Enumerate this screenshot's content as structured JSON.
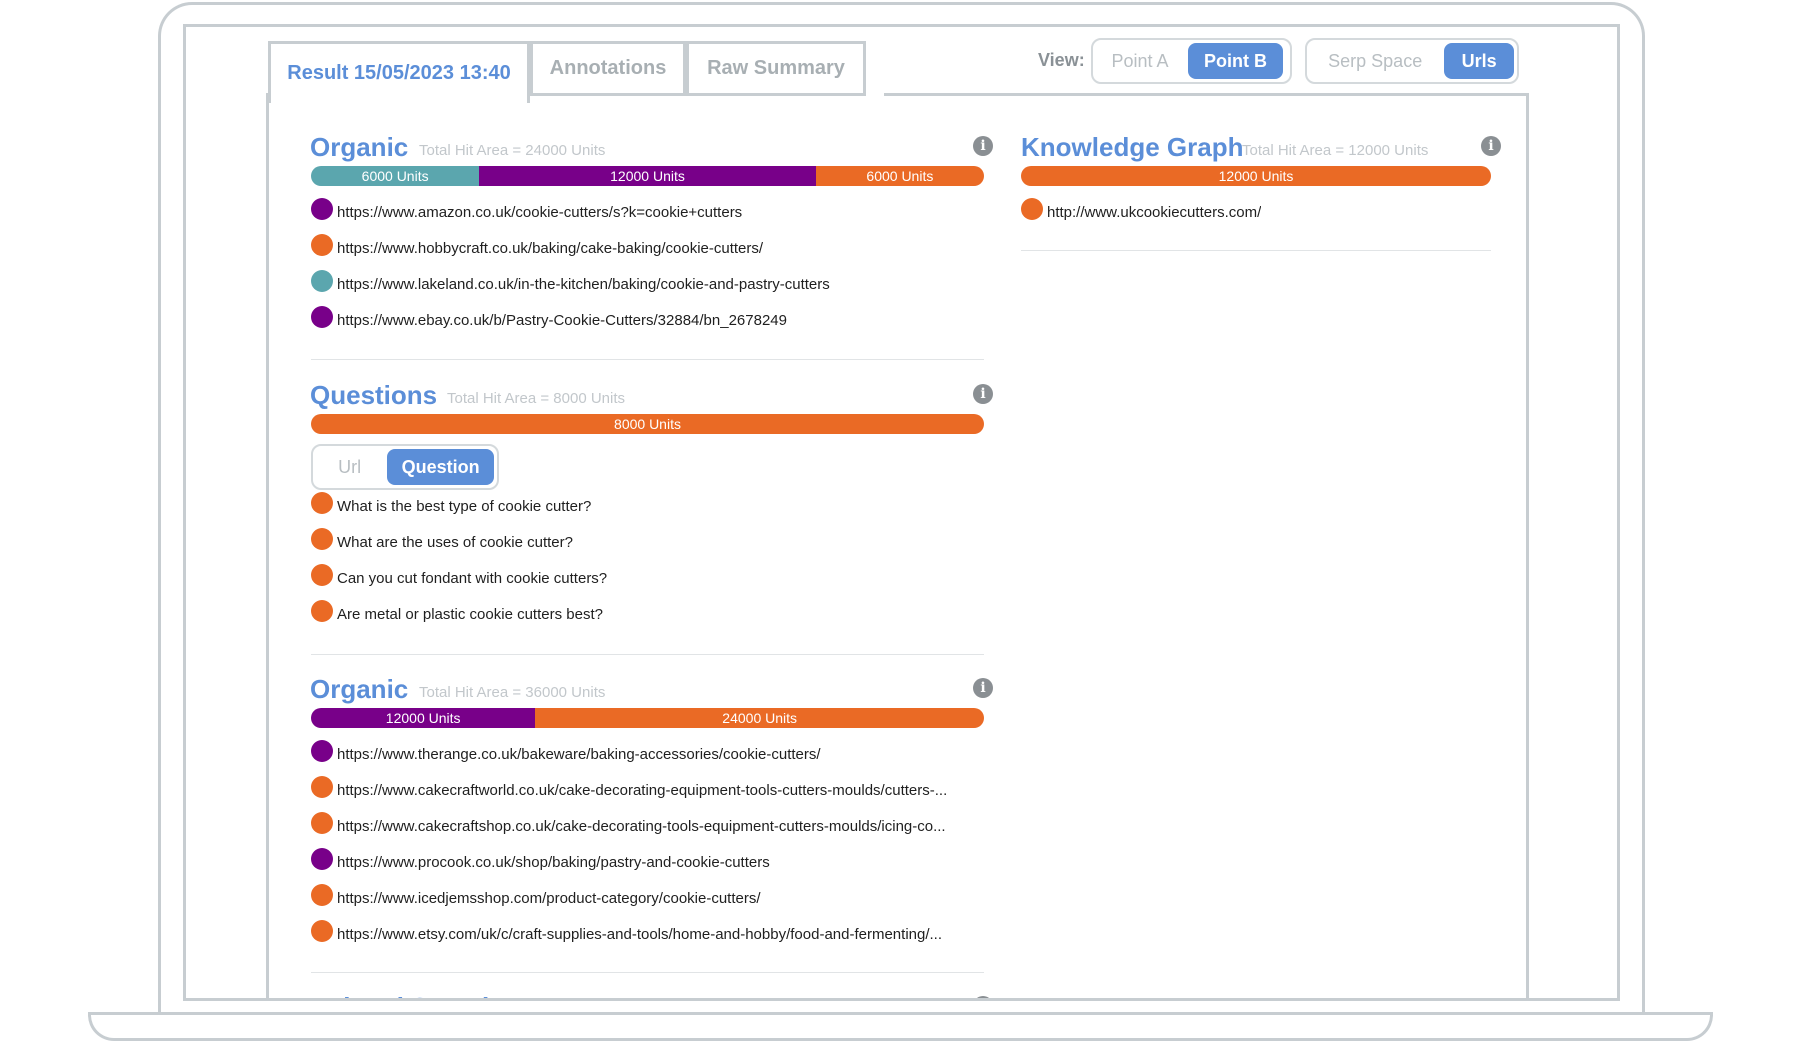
{
  "tabs": [
    {
      "label": "Result 15/05/2023 13:40",
      "active": true
    },
    {
      "label": "Annotations",
      "active": false
    },
    {
      "label": "Raw Summary",
      "active": false
    }
  ],
  "view": {
    "label": "View:",
    "point_group": [
      {
        "label": "Point A",
        "selected": false
      },
      {
        "label": "Point B",
        "selected": true
      }
    ],
    "space_group": [
      {
        "label": "Serp Space",
        "selected": false
      },
      {
        "label": "Urls",
        "selected": true
      }
    ]
  },
  "colors": {
    "teal": "#5ba6ae",
    "purple": "#780089",
    "orange": "#ea6a25",
    "accent": "#5b8ed8"
  },
  "sections": {
    "organic1": {
      "title": "Organic",
      "subtitle": "Total Hit Area = 24000 Units",
      "bar": [
        {
          "label": "6000 Units",
          "value": 6000,
          "color": "teal"
        },
        {
          "label": "12000 Units",
          "value": 12000,
          "color": "purple"
        },
        {
          "label": "6000 Units",
          "value": 6000,
          "color": "orange"
        }
      ],
      "items": [
        {
          "text": "https://www.amazon.co.uk/cookie-cutters/s?k=cookie+cutters",
          "color": "purple"
        },
        {
          "text": "https://www.hobbycraft.co.uk/baking/cake-baking/cookie-cutters/",
          "color": "orange"
        },
        {
          "text": "https://www.lakeland.co.uk/in-the-kitchen/baking/cookie-and-pastry-cutters",
          "color": "teal"
        },
        {
          "text": "https://www.ebay.co.uk/b/Pastry-Cookie-Cutters/32884/bn_2678249",
          "color": "purple"
        }
      ]
    },
    "knowledge": {
      "title": "Knowledge Graph",
      "subtitle": "Total Hit Area = 12000 Units",
      "bar": [
        {
          "label": "12000 Units",
          "value": 12000,
          "color": "orange"
        }
      ],
      "items": [
        {
          "text": "http://www.ukcookiecutters.com/",
          "color": "orange"
        }
      ]
    },
    "questions": {
      "title": "Questions",
      "subtitle": "Total Hit Area = 8000 Units",
      "bar": [
        {
          "label": "8000 Units",
          "value": 8000,
          "color": "orange"
        }
      ],
      "toggle": [
        {
          "label": "Url",
          "selected": false
        },
        {
          "label": "Question",
          "selected": true
        }
      ],
      "items": [
        {
          "text": "What is the best type of cookie cutter?",
          "color": "orange"
        },
        {
          "text": "What are the uses of cookie cutter?",
          "color": "orange"
        },
        {
          "text": "Can you cut fondant with cookie cutters?",
          "color": "orange"
        },
        {
          "text": "Are metal or plastic cookie cutters best?",
          "color": "orange"
        }
      ]
    },
    "organic2": {
      "title": "Organic",
      "subtitle": "Total Hit Area = 36000 Units",
      "bar": [
        {
          "label": "12000 Units",
          "value": 12000,
          "color": "purple"
        },
        {
          "label": "24000 Units",
          "value": 24000,
          "color": "orange"
        }
      ],
      "items": [
        {
          "text": "https://www.therange.co.uk/bakeware/baking-accessories/cookie-cutters/",
          "color": "purple"
        },
        {
          "text": "https://www.cakecraftworld.co.uk/cake-decorating-equipment-tools-cutters-moulds/cutters-...",
          "color": "orange"
        },
        {
          "text": "https://www.cakecraftshop.co.uk/cake-decorating-tools-equipment-cutters-moulds/icing-co...",
          "color": "orange"
        },
        {
          "text": "https://www.procook.co.uk/shop/baking/pastry-and-cookie-cutters",
          "color": "purple"
        },
        {
          "text": "https://www.icedjemsshop.com/product-category/cookie-cutters/",
          "color": "orange"
        },
        {
          "text": "https://www.etsy.com/uk/c/craft-supplies-and-tools/home-and-hobby/food-and-fermenting/...",
          "color": "orange"
        }
      ]
    },
    "related": {
      "title": "Related Searches"
    }
  },
  "info_icon": "info-icon"
}
